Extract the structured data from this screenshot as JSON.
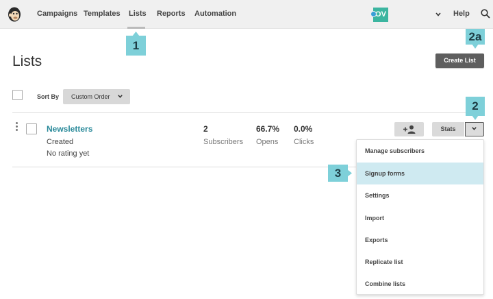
{
  "nav": {
    "items": [
      "Campaigns",
      "Templates",
      "Lists",
      "Reports",
      "Automation"
    ],
    "active": "Lists",
    "avatar_initials": "OV",
    "help_label": "Help"
  },
  "callouts": {
    "c1": "1",
    "c2": "2",
    "c2a": "2a",
    "c3": "3"
  },
  "page": {
    "title": "Lists",
    "create_button": "Create List",
    "sort_by_label": "Sort By",
    "sort_value": "Custom Order"
  },
  "list_row": {
    "name": "Newsletters",
    "created_label": "Created",
    "rating": "No rating yet",
    "stats": [
      {
        "value": "2",
        "label": "Subscribers"
      },
      {
        "value": "66.7%",
        "label": "Opens"
      },
      {
        "value": "0.0%",
        "label": "Clicks"
      }
    ],
    "stats_button": "Stats"
  },
  "dropdown": {
    "items": [
      "Manage subscribers",
      "Signup forms",
      "Settings",
      "Import",
      "Exports",
      "Replicate list",
      "Combine lists"
    ],
    "highlighted": "Signup forms"
  },
  "colors": {
    "accent_link": "#2a8a9a",
    "callout": "#7ed0d9",
    "highlight": "#cfeaf1",
    "avatar": "#3cb5a0"
  }
}
